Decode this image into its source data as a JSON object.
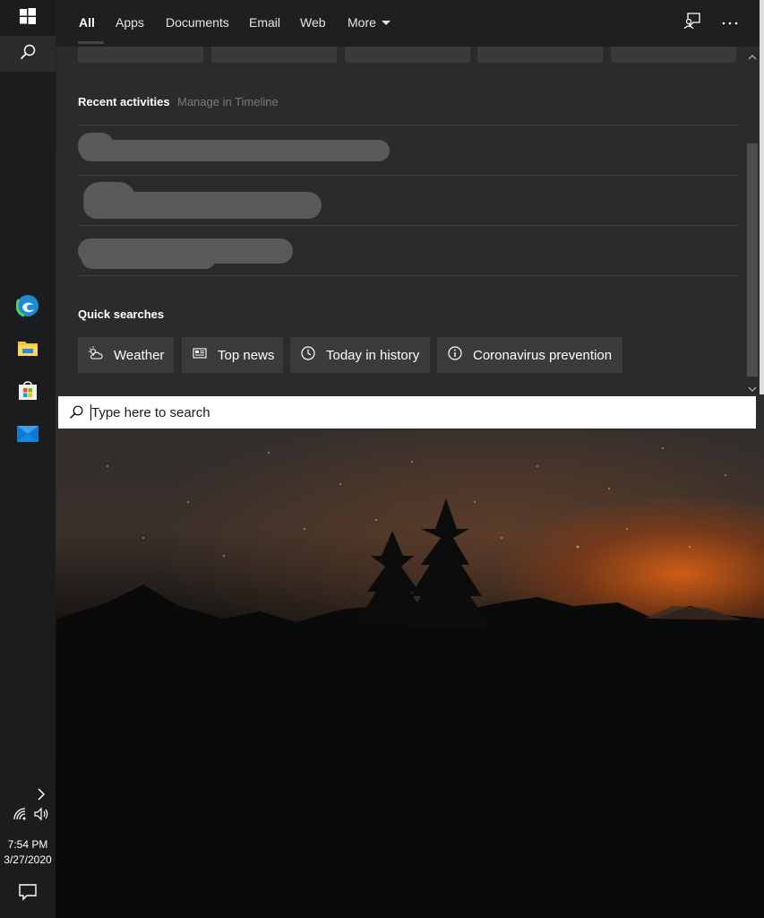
{
  "taskbar": {
    "start_icon": "windows-logo-icon",
    "search_icon": "search-icon",
    "pinned_apps": [
      {
        "name": "Microsoft Edge",
        "icon": "edge-icon"
      },
      {
        "name": "File Explorer",
        "icon": "folder-icon"
      },
      {
        "name": "Microsoft Store",
        "icon": "store-icon"
      },
      {
        "name": "Mail",
        "icon": "mail-icon"
      }
    ],
    "clock_time": "7:54 PM",
    "clock_date": "3/27/2020"
  },
  "search": {
    "tabs": [
      {
        "label": "All",
        "active": true
      },
      {
        "label": "Apps"
      },
      {
        "label": "Documents"
      },
      {
        "label": "Email"
      },
      {
        "label": "Web"
      },
      {
        "label": "More"
      }
    ],
    "recent": {
      "title": "Recent activities",
      "manage_link": "Manage in Timeline"
    },
    "quick_searches": {
      "title": "Quick searches",
      "chips": [
        {
          "label": "Weather",
          "icon": "weather-icon"
        },
        {
          "label": "Top news",
          "icon": "news-icon"
        },
        {
          "label": "Today in history",
          "icon": "clock-icon"
        },
        {
          "label": "Coronavirus prevention",
          "icon": "info-icon"
        }
      ]
    },
    "input": {
      "placeholder": "Type here to search",
      "value": ""
    }
  },
  "colors": {
    "flyout_bg": "#2b2b2b",
    "nav_bg": "#1f1f1f",
    "chip_bg": "#3b3b3b",
    "taskbar_bg": "#1b1c1e",
    "edge_blue": "#1f8ad3",
    "store_accent": "#f25022"
  }
}
